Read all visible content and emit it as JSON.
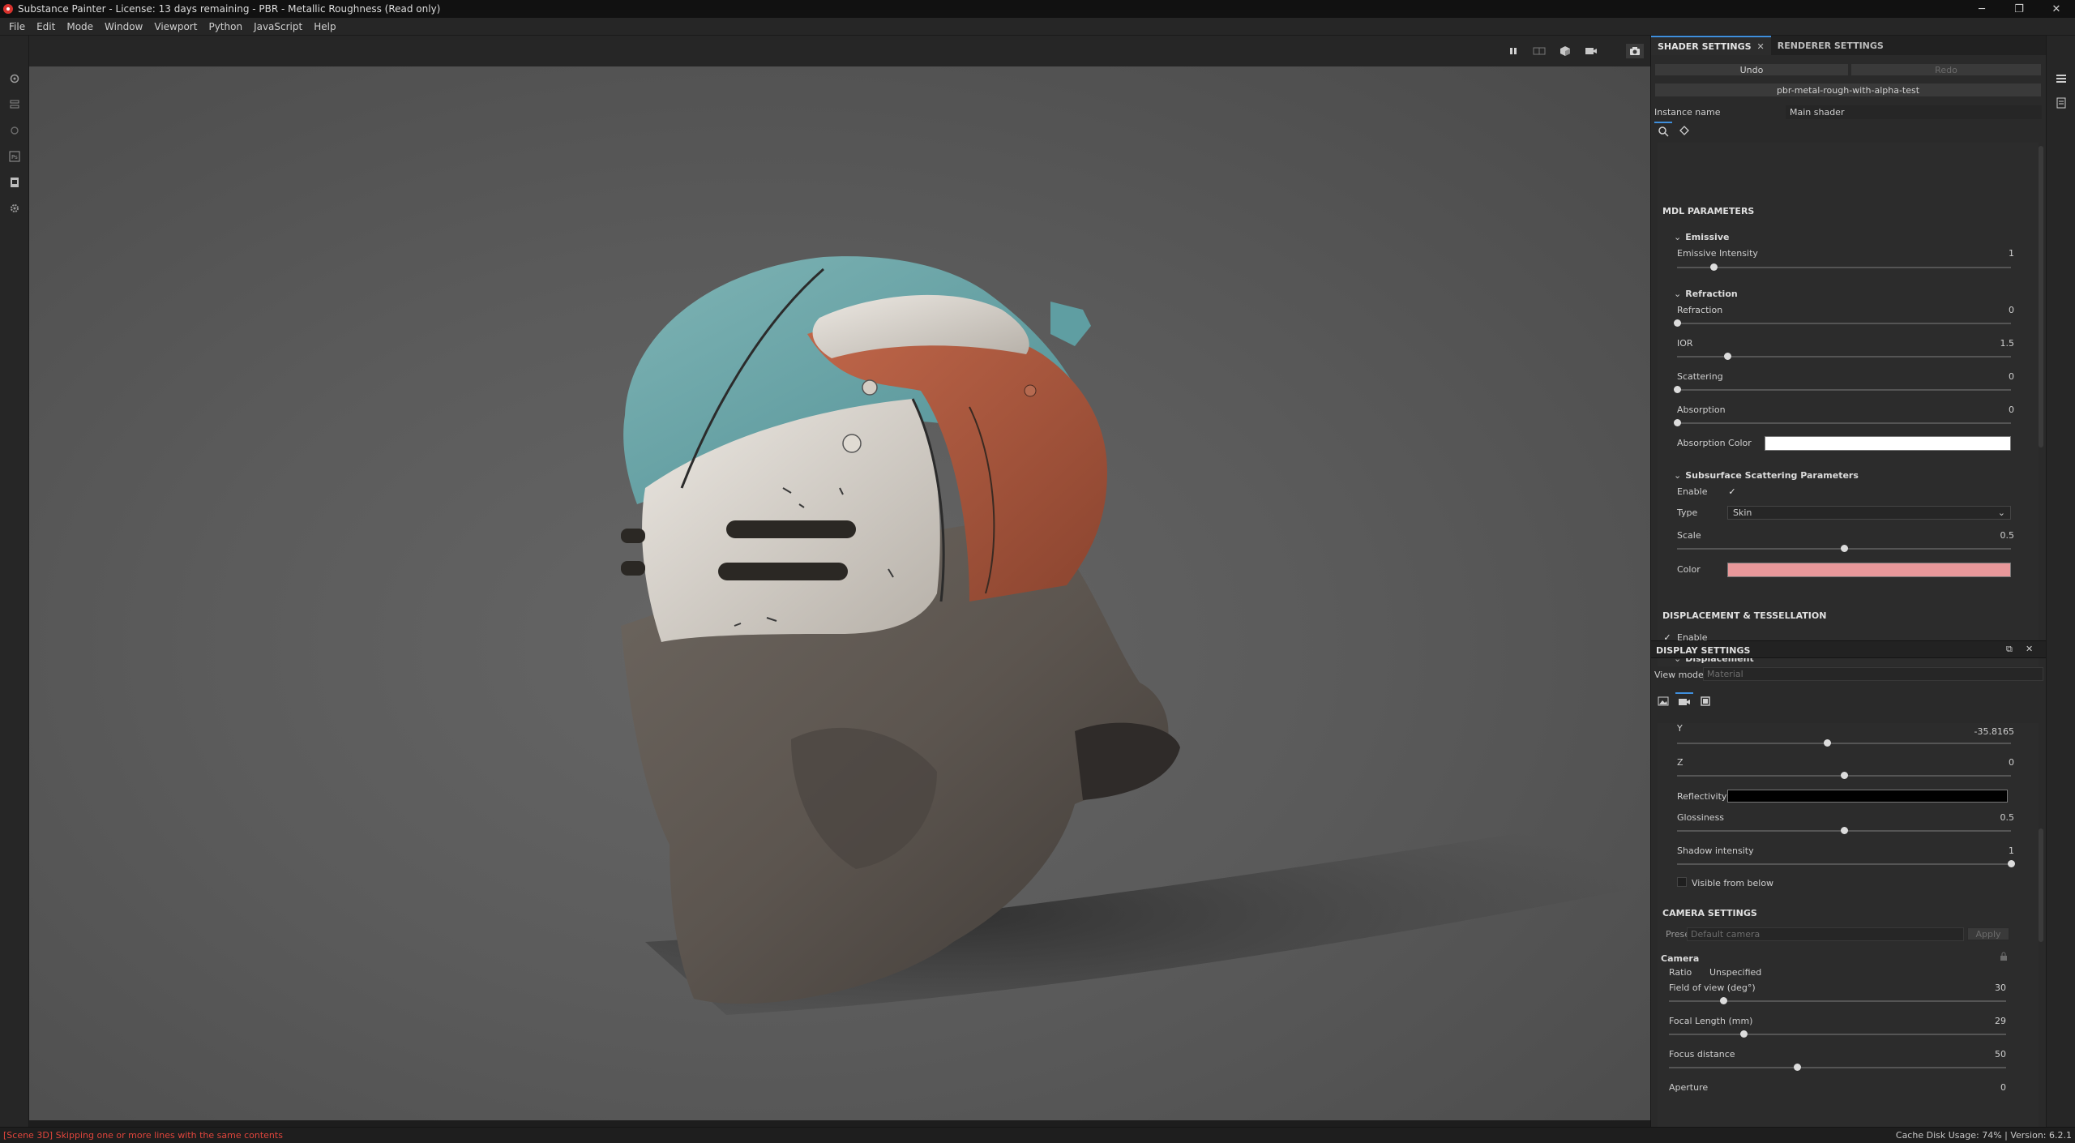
{
  "window": {
    "title": "Substance Painter - License: 13 days remaining - PBR - Metallic Roughness (Read only)",
    "controls": {
      "minimize": "─",
      "maximize": "❐",
      "close": "✕"
    }
  },
  "menu": [
    "File",
    "Edit",
    "Mode",
    "Window",
    "Viewport",
    "Python",
    "JavaScript",
    "Help"
  ],
  "status": {
    "log": "[Scene 3D] Skipping one or more lines with the same contents",
    "cache": "Cache Disk Usage:    74% | Version: 6.2.1"
  },
  "shader_panel": {
    "tabs": [
      {
        "label": "SHADER SETTINGS",
        "close": "✕"
      },
      {
        "label": "RENDERER SETTINGS"
      }
    ],
    "undo": "Undo",
    "redo": "Redo",
    "shader_name": "pbr-metal-rough-with-alpha-test",
    "instance_label": "Instance name",
    "instance_value": "Main shader",
    "mdl_title": "MDL PARAMETERS",
    "emissive": {
      "title": "Emissive",
      "intensity_label": "Emissive Intensity",
      "intensity_value": "1",
      "intensity_level": 0.11
    },
    "refraction": {
      "title": "Refraction",
      "refraction_label": "Refraction",
      "refraction_value": "0",
      "refraction_level": 0.0,
      "ior_label": "IOR",
      "ior_value": "1.5",
      "ior_level": 0.15,
      "scattering_label": "Scattering",
      "scattering_value": "0",
      "scattering_level": 0.0,
      "absorption_label": "Absorption",
      "absorption_value": "0",
      "absorption_level": 0.0,
      "absorption_color_label": "Absorption Color",
      "absorption_color": "#ffffff"
    },
    "sss": {
      "title": "Subsurface Scattering Parameters",
      "enable_label": "Enable",
      "enable_check": "✓",
      "type_label": "Type",
      "type_value": "Skin",
      "scale_label": "Scale",
      "scale_value": "0.5",
      "scale_level": 0.5,
      "color_label": "Color",
      "color": "#e8989a"
    },
    "displacement_title": "DISPLACEMENT & TESSELLATION",
    "displacement_enable": "Enable",
    "displacement_check": "✓",
    "displacement_group": "Displacement"
  },
  "display_panel": {
    "title": "DISPLAY SETTINGS",
    "view_mode_label": "View mode",
    "view_mode_value": "Material",
    "y_label": "Y",
    "y_value": "-35.8165",
    "y_level": 0.45,
    "z_label": "Z",
    "z_value": "0",
    "z_level": 0.5,
    "reflectivity_label": "Reflectivity",
    "reflectivity_color": "#000000",
    "glossiness_label": "Glossiness",
    "glossiness_value": "0.5",
    "glossiness_level": 0.5,
    "shadow_label": "Shadow intensity",
    "shadow_value": "1",
    "shadow_level": 1.0,
    "visible_below_label": "Visible from below",
    "camera_title": "CAMERA SETTINGS",
    "preset_label": "Preset",
    "preset_value": "Default camera",
    "preset_apply": "Apply",
    "camera_group": "Camera",
    "ratio_label": "Ratio",
    "ratio_value": "Unspecified",
    "fov_label": "Field of view (deg°)",
    "fov_value": "30",
    "fov_level": 0.16,
    "focal_label": "Focal Length (mm)",
    "focal_value": "29",
    "focal_level": 0.22,
    "focus_label": "Focus distance",
    "focus_value": "50",
    "focus_level": 0.38,
    "aperture_label": "Aperture",
    "aperture_value": "0"
  },
  "icons": {
    "left_strip": [
      "settings-icon",
      "layers-stack-icon",
      "bake-icon",
      "photoshop-icon",
      "export-icon",
      "gear-icon"
    ],
    "viewport_tools": [
      "pause-icon",
      "split-view-icon",
      "cube-icon",
      "camera-icon",
      "screenshot-icon"
    ],
    "right_strip": [
      "list-icon",
      "document-icon"
    ]
  },
  "colors": {
    "accent": "#3f8fdd",
    "status_error": "#e0453c",
    "sss_color": "#e8989a"
  }
}
